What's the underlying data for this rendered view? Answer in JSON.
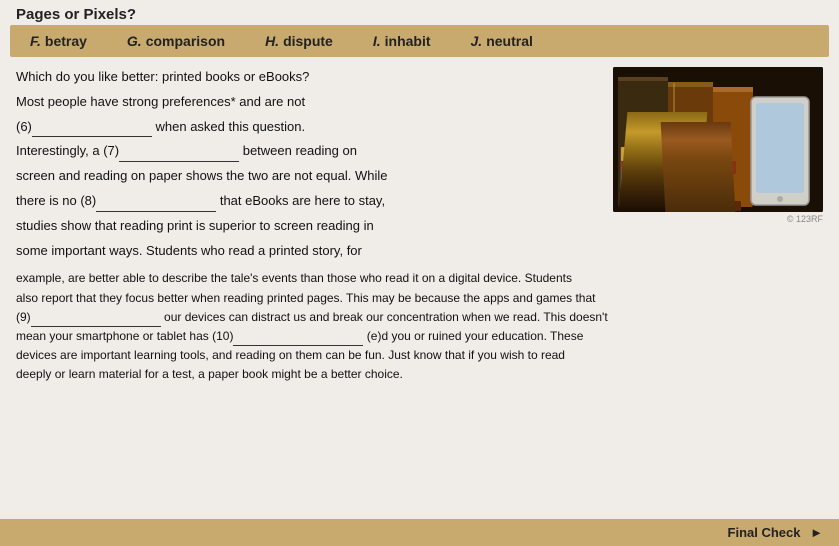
{
  "page": {
    "title": "Pages or Pixels?",
    "vocab_bar": {
      "items": [
        {
          "letter": "F.",
          "word": "betray"
        },
        {
          "letter": "G.",
          "word": "comparison"
        },
        {
          "letter": "H.",
          "word": "dispute"
        },
        {
          "letter": "I.",
          "word": "inhabit"
        },
        {
          "letter": "J.",
          "word": "neutral"
        }
      ]
    },
    "paragraph1_start": "Which do you like better: printed books or eBooks?",
    "paragraph1_line2": "Most people have strong preferences* and are not",
    "paragraph1_6label": "(6)",
    "paragraph1_when": "when",
    "paragraph1_asked": "asked",
    "paragraph1_this": "this",
    "paragraph1_question": "question.",
    "paragraph1_interestingly": "Interestingly, a (7)",
    "paragraph1_between": "between reading on",
    "paragraph1_screen": "screen and reading on paper shows the two are not equal. While",
    "paragraph1_there": "there is no (8)",
    "paragraph1_that": "that eBooks are here to stay,",
    "paragraph1_studies": "studies show that reading print is superior to screen reading in",
    "paragraph1_some": "some important ways. Students who read a printed story, for",
    "paragraph2_example": "example, are better able to describe the tale's events than those who read it on a digital device. Students",
    "paragraph2_also": "also report that they focus better when reading printed pages. This may be because the apps and games that",
    "paragraph2_9label": "(9)",
    "paragraph2_our": "our devices can distract us and break our concentration when we read. This doesn't",
    "paragraph2_mean": "mean your smartphone or tablet has (10)",
    "paragraph2_eld": "(e)d you or ruined your education. These",
    "paragraph2_devices": "devices are important learning tools, and reading on them can be fun. Just know that if you wish to read",
    "paragraph2_deeply": "deeply or learn material for a test, a paper book might be a better choice.",
    "bottom_label": "Final Check",
    "image_alt": "Stack of books with tablet"
  }
}
